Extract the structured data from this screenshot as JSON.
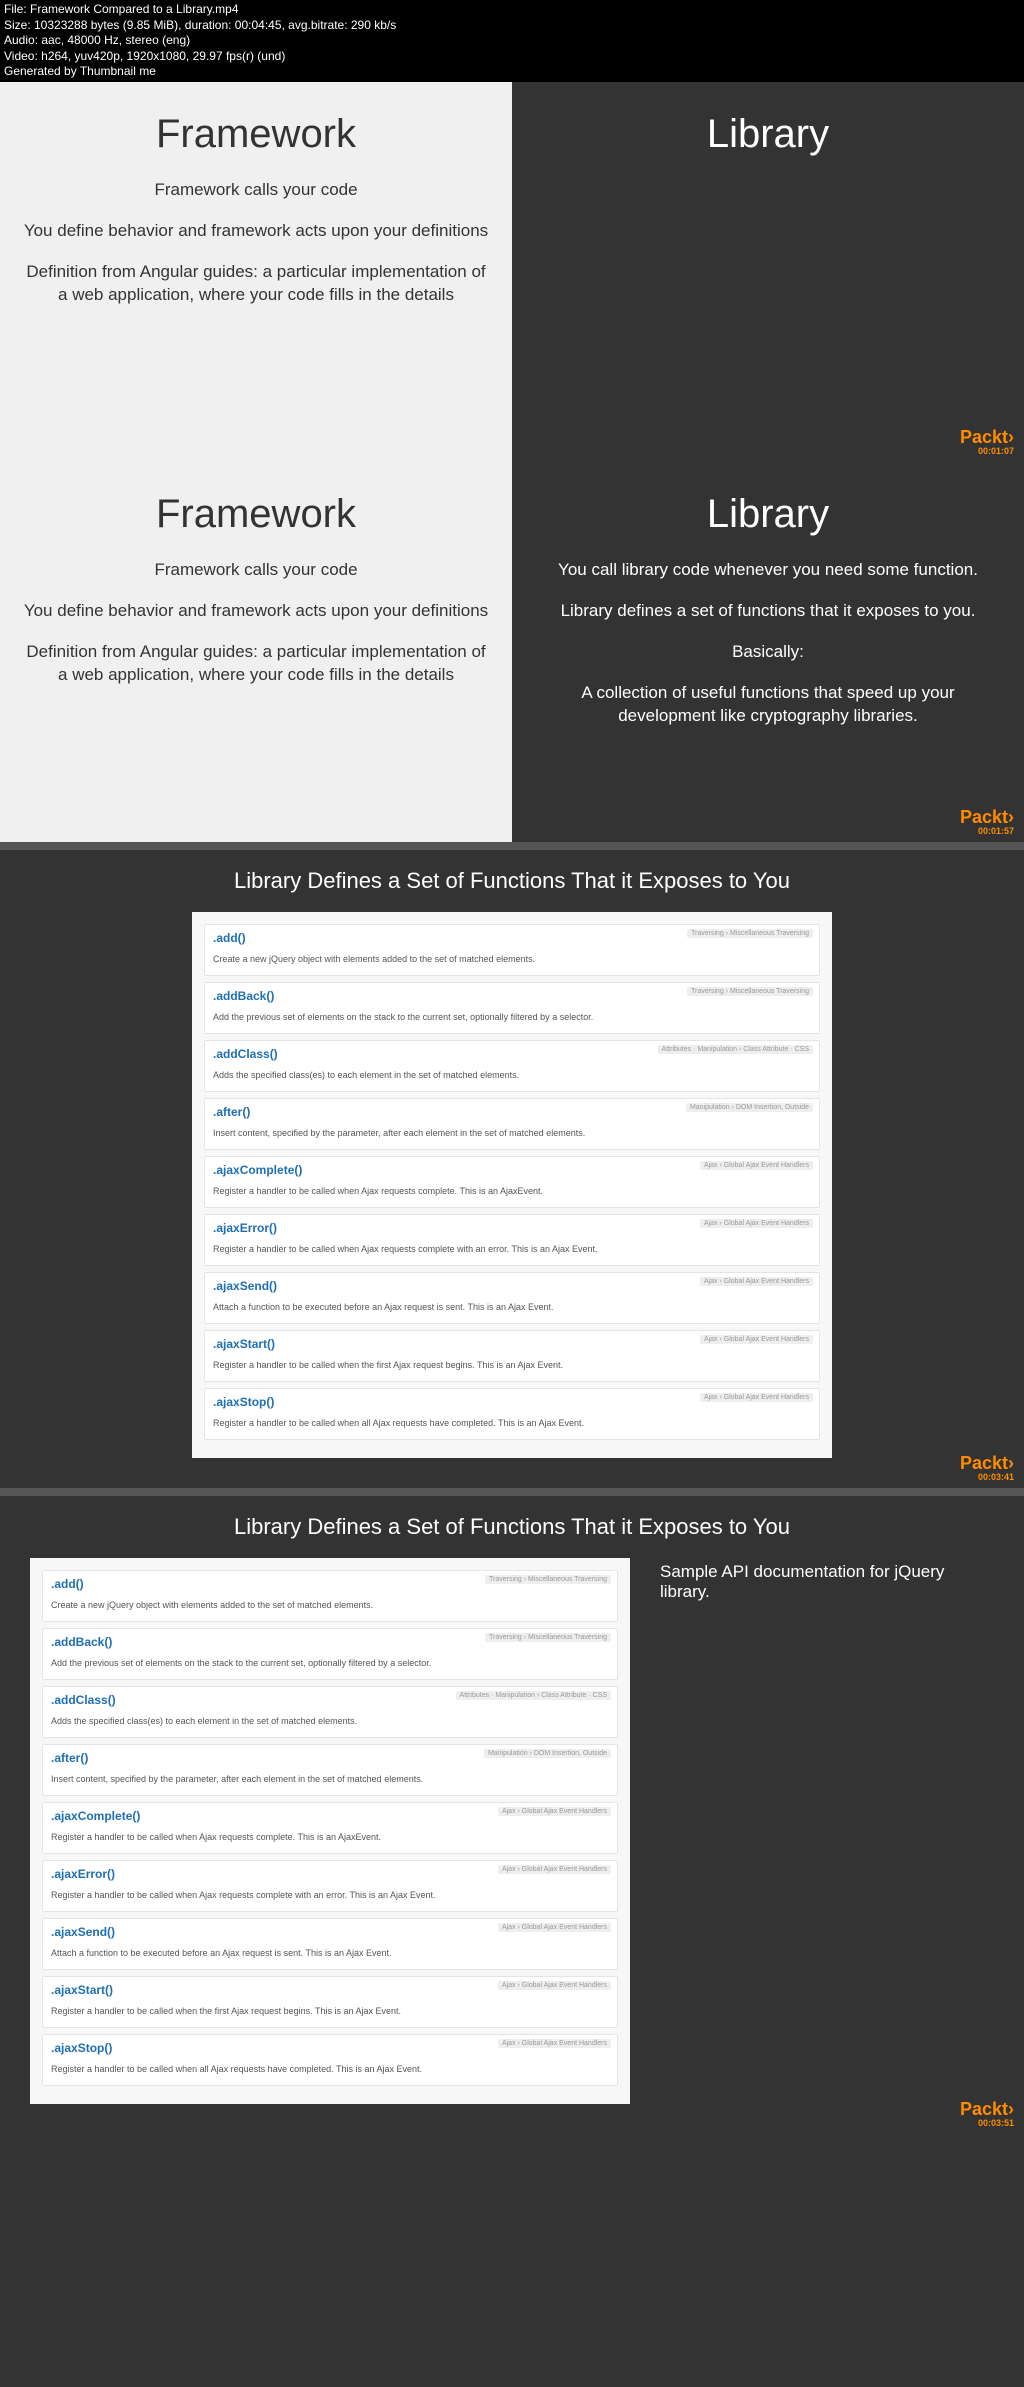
{
  "meta": {
    "l1": "File: Framework Compared to a Library.mp4",
    "l2": "Size: 10323288 bytes (9.85 MiB), duration: 00:04:45, avg.bitrate: 290 kb/s",
    "l3": "Audio: aac, 48000 Hz, stereo (eng)",
    "l4": "Video: h264, yuv420p, 1920x1080, 29.97 fps(r) (und)",
    "l5": "Generated by Thumbnail me"
  },
  "slide1": {
    "left_h": "Framework",
    "left_p1": "Framework calls your code",
    "left_p2": "You define behavior and framework acts upon your definitions",
    "left_p3": "Definition from Angular guides: a particular implementation of a web application, where your code fills in the details",
    "right_h": "Library",
    "brand": "Packt›",
    "ts": "00:01:07"
  },
  "slide2": {
    "left_h": "Framework",
    "left_p1": "Framework calls your code",
    "left_p2": "You define behavior and framework acts upon your definitions",
    "left_p3": "Definition from Angular guides: a particular implementation of a web application, where your code fills in the details",
    "right_h": "Library",
    "right_p1": "You call library code whenever you need some function.",
    "right_p2": "Library defines a set of functions that it exposes to you.",
    "right_p3": "Basically:",
    "right_p4": "A collection of useful functions that speed up your development like cryptography libraries.",
    "brand": "Packt›",
    "ts": "00:01:57"
  },
  "slide3": {
    "title": "Library Defines a Set of Functions That it Exposes to You",
    "brand": "Packt›",
    "ts": "00:03:41"
  },
  "slide4": {
    "title": "Library Defines a Set of Functions That it Exposes to You",
    "side": "Sample API documentation for jQuery library.",
    "brand": "Packt›",
    "ts": "00:03:51"
  },
  "api": [
    {
      "name": ".add()",
      "desc": "Create a new jQuery object with elements added to the set of matched elements.",
      "tags": "Traversing › Miscellaneous Traversing"
    },
    {
      "name": ".addBack()",
      "desc": "Add the previous set of elements on the stack to the current set, optionally filtered by a selector.",
      "tags": "Traversing › Miscellaneous Traversing"
    },
    {
      "name": ".addClass()",
      "desc": "Adds the specified class(es) to each element in the set of matched elements.",
      "tags": "Attributes · Manipulation › Class Attribute · CSS"
    },
    {
      "name": ".after()",
      "desc": "Insert content, specified by the parameter, after each element in the set of matched elements.",
      "tags": "Manipulation › DOM Insertion, Outside"
    },
    {
      "name": ".ajaxComplete()",
      "desc": "Register a handler to be called when Ajax requests complete. This is an AjaxEvent.",
      "tags": "Ajax › Global Ajax Event Handlers"
    },
    {
      "name": ".ajaxError()",
      "desc": "Register a handler to be called when Ajax requests complete with an error. This is an Ajax Event.",
      "tags": "Ajax › Global Ajax Event Handlers"
    },
    {
      "name": ".ajaxSend()",
      "desc": "Attach a function to be executed before an Ajax request is sent. This is an Ajax Event.",
      "tags": "Ajax › Global Ajax Event Handlers"
    },
    {
      "name": ".ajaxStart()",
      "desc": "Register a handler to be called when the first Ajax request begins. This is an Ajax Event.",
      "tags": "Ajax › Global Ajax Event Handlers"
    },
    {
      "name": ".ajaxStop()",
      "desc": "Register a handler to be called when all Ajax requests have completed. This is an Ajax Event.",
      "tags": "Ajax › Global Ajax Event Handlers"
    }
  ]
}
